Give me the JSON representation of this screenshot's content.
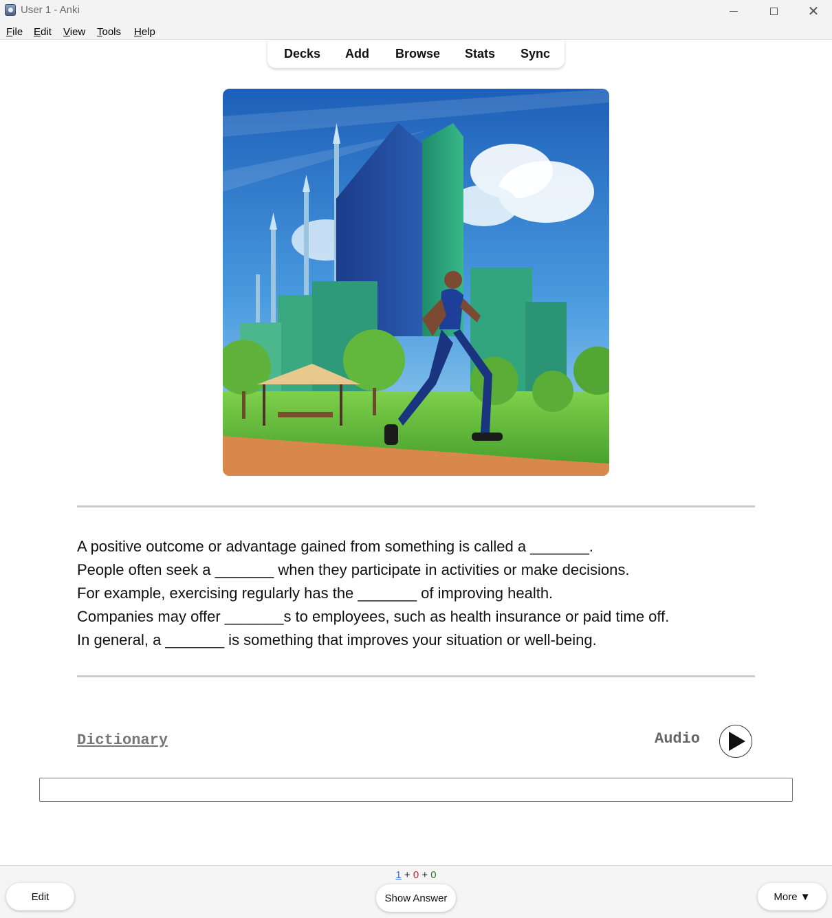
{
  "window": {
    "title": "User 1 - Anki",
    "controls": {
      "minimize": "minimize-icon",
      "maximize": "maximize-icon",
      "close": "close-icon"
    }
  },
  "menu": [
    {
      "label": "File",
      "accel": "F",
      "rest": "ile"
    },
    {
      "label": "Edit",
      "accel": "E",
      "rest": "dit"
    },
    {
      "label": "View",
      "accel": "V",
      "rest": "iew"
    },
    {
      "label": "Tools",
      "accel": "T",
      "rest": "ools"
    },
    {
      "label": "Help",
      "accel": "H",
      "rest": "elp"
    }
  ],
  "toolbar": [
    "Decks",
    "Add",
    "Browse",
    "Stats",
    "Sync"
  ],
  "card": {
    "sentences": [
      "A positive outcome or advantage gained from something is called a _______.",
      "People often seek a _______ when they participate in activities or make decisions.",
      "For example, exercising regularly has the _______ of improving health.",
      "Companies may offer _______s to employees, such as health insurance or paid time off.",
      "In general, a _______ is something that improves your situation or well-being."
    ],
    "dictionary_label": "Dictionary",
    "audio_label": "Audio",
    "audio_icon": "play-icon",
    "answer_input_value": ""
  },
  "bottom": {
    "counts": {
      "new": "1",
      "learning": "0",
      "review": "0",
      "sep": "+"
    },
    "edit_label": "Edit",
    "show_answer_label": "Show Answer",
    "more_label": "More ▼"
  },
  "colors": {
    "new": "#3b6ee0",
    "learning": "#c62828",
    "review": "#2e7d32"
  }
}
